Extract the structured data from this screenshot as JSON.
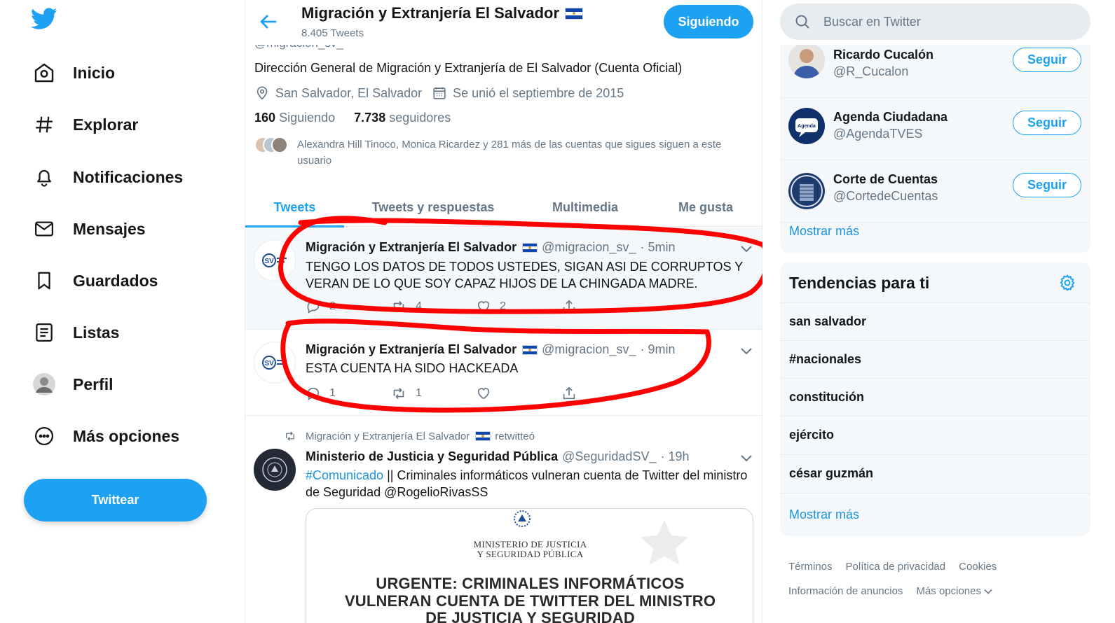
{
  "nav": {
    "items": [
      {
        "label": "Inicio",
        "icon": "home-icon"
      },
      {
        "label": "Explorar",
        "icon": "hashtag-icon"
      },
      {
        "label": "Notificaciones",
        "icon": "bell-icon"
      },
      {
        "label": "Mensajes",
        "icon": "mail-icon"
      },
      {
        "label": "Guardados",
        "icon": "bookmark-icon"
      },
      {
        "label": "Listas",
        "icon": "list-icon"
      },
      {
        "label": "Perfil",
        "icon": "avatar"
      },
      {
        "label": "Más opciones",
        "icon": "more-circle-icon"
      }
    ],
    "tweet_button": "Twittear"
  },
  "profile": {
    "name": "Migración y Extranjería El Salvador",
    "tweet_count": "8.405 Tweets",
    "following_button": "Siguiendo",
    "handle": "@migracion_sv_",
    "bio": "Dirección General de Migración y Extranjería de El Salvador (Cuenta Oficial)",
    "location": "San Salvador, El Salvador",
    "joined": "Se unió el septiembre de 2015",
    "following_count": "160",
    "following_label": "Siguiendo",
    "followers_count": "7.738",
    "followers_label": "seguidores",
    "followers_you_know": "Alexandra Hill Tinoco, Monica Ricardez y 281 más de las cuentas que sigues siguen a este usuario"
  },
  "tabs": [
    "Tweets",
    "Tweets y respuestas",
    "Multimedia",
    "Me gusta"
  ],
  "tweets": [
    {
      "name": "Migración y Extranjería El Salvador",
      "handle": "@migracion_sv_",
      "time": "· 5min",
      "text": "TENGO LOS DATOS DE TODOS USTEDES, SIGAN ASI DE CORRUPTOS Y VERAN DE LO QUE SOY CAPAZ HIJOS DE LA CHINGADA MADRE.",
      "replies": "2",
      "retweets": "4",
      "likes": "2"
    },
    {
      "name": "Migración y Extranjería El Salvador",
      "handle": "@migracion_sv_",
      "time": "· 9min",
      "text": "ESTA CUENTA HA SIDO HACKEADA",
      "replies": "1",
      "retweets": "1",
      "likes": ""
    },
    {
      "retweeted_by": "Migración y Extranjería El Salvador",
      "retweeted_label": "retwitteó",
      "name": "Ministerio de Justicia y Seguridad Pública",
      "handle": "@SeguridadSV_",
      "time": "· 19h",
      "hashtag": "#Comunicado",
      "text": "|| Criminales informáticos vulneran cuenta de Twitter del ministro de Seguridad @RogelioRivasSS",
      "card": {
        "org_line1": "MINISTERIO DE JUSTICIA",
        "org_line2": "Y SEGURIDAD PÚBLICA",
        "headline1": "URGENTE: CRIMINALES INFORMÁTICOS",
        "headline2": "VULNERAN CUENTA DE TWITTER DEL MINISTRO",
        "headline3": "DE JUSTICIA Y SEGURIDAD"
      }
    }
  ],
  "search": {
    "placeholder": "Buscar en Twitter"
  },
  "who_to_follow": {
    "accounts": [
      {
        "name": "Ricardo Cucalón",
        "handle": "@R_Cucalon",
        "button": "Seguir"
      },
      {
        "name": "Agenda Ciudadana",
        "handle": "@AgendaTVES",
        "button": "Seguir",
        "avatar_text": "Agenda"
      },
      {
        "name": "Corte de Cuentas",
        "handle": "@CortedeCuentas",
        "button": "Seguir"
      }
    ],
    "show_more": "Mostrar más"
  },
  "trends": {
    "title": "Tendencias para ti",
    "items": [
      "san salvador",
      "#nacionales",
      "constitución",
      "ejército",
      "césar guzmán"
    ],
    "show_more": "Mostrar más"
  },
  "footer": {
    "links": [
      "Términos",
      "Política de privacidad",
      "Cookies"
    ],
    "links2": [
      "Información de anuncios",
      "Más opciones"
    ]
  },
  "colors": {
    "accent": "#1da1f2",
    "annotation": "#ff0000",
    "text": "#14171a",
    "muted": "#657786"
  }
}
